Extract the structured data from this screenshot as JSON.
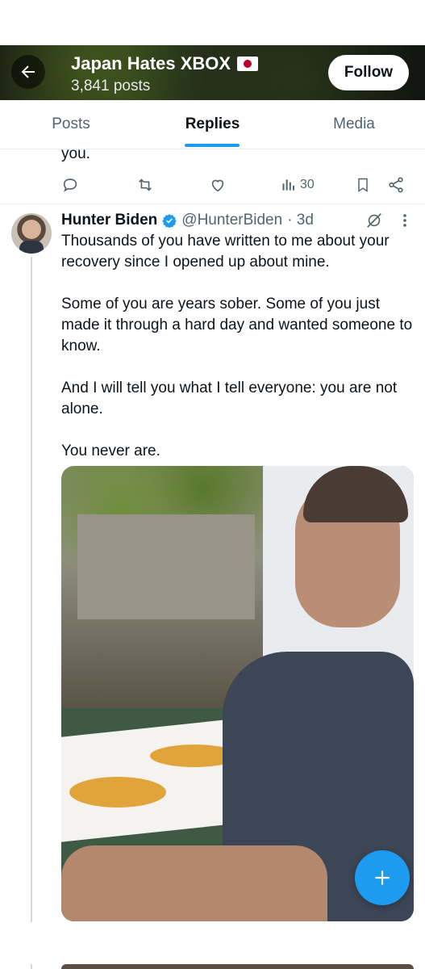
{
  "header": {
    "title": "Japan Hates XBOX",
    "post_count": "3,841 posts",
    "follow_label": "Follow"
  },
  "tabs": [
    {
      "label": "Posts"
    },
    {
      "label": "Replies"
    },
    {
      "label": "Media"
    }
  ],
  "previous_tweet": {
    "trailing_text": "you.",
    "views": "30"
  },
  "tweet": {
    "author_name": "Hunter Biden",
    "handle": "@HunterBiden",
    "time": "· 3d",
    "paragraphs": [
      "Thousands of you have written to me about your recovery since I opened up about mine.",
      "Some of you are years sober. Some of you just made it through a hard day and wanted someone to know.",
      "And I will tell you what I tell everyone: you are not alone.",
      "You never are."
    ]
  },
  "colors": {
    "accent": "#1d9bf0",
    "text_primary": "#0f1419",
    "text_secondary": "#536471"
  },
  "icons": [
    "back-arrow-icon",
    "japan-flag-icon",
    "reply-icon",
    "retweet-icon",
    "like-icon",
    "views-icon",
    "bookmark-icon",
    "share-icon",
    "verified-icon",
    "grok-icon",
    "more-icon",
    "compose-plus-icon"
  ]
}
